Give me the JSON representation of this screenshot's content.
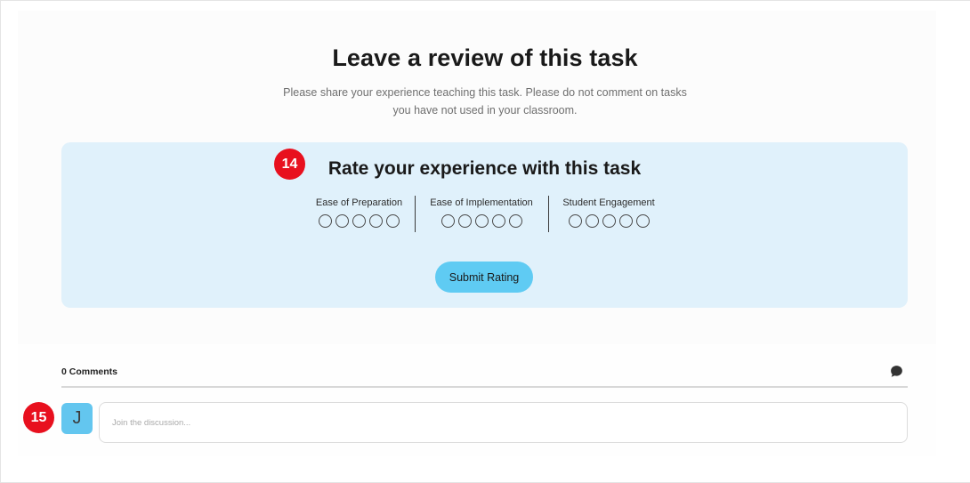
{
  "review": {
    "title": "Leave a review of this task",
    "subtitle_line1": "Please share your experience teaching this task. Please do not comment on tasks",
    "subtitle_line2": "you have not used in your classroom."
  },
  "rating": {
    "title": "Rate your experience with this task",
    "criteria": [
      {
        "label": "Ease of Preparation",
        "scale": 5,
        "selected": 0
      },
      {
        "label": "Ease of Implementation",
        "scale": 5,
        "selected": 0
      },
      {
        "label": "Student Engagement",
        "scale": 5,
        "selected": 0
      }
    ],
    "submit_label": "Submit Rating"
  },
  "badges": {
    "first": "14",
    "second": "15"
  },
  "comments": {
    "count_label": "0 Comments",
    "icon": "speech-bubble-icon",
    "avatar_initial": "J",
    "input_placeholder": "Join the discussion..."
  },
  "colors": {
    "rating_card_bg": "#e0f1fb",
    "submit_button": "#5fcbf3",
    "avatar_bg": "#63c6ef",
    "badge": "#e8101e"
  }
}
